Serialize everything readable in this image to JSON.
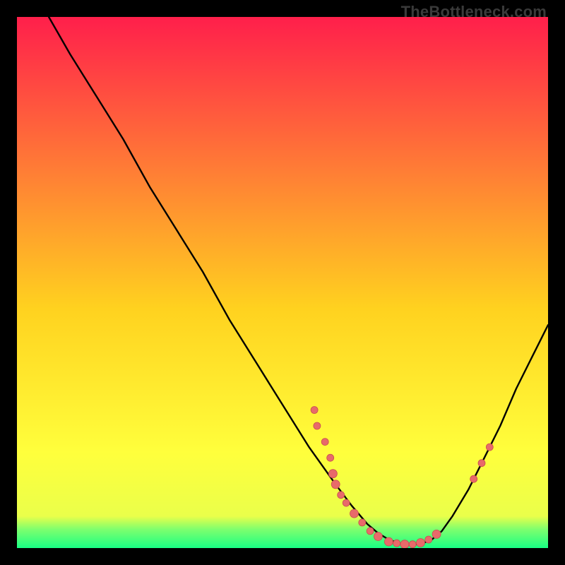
{
  "watermark": "TheBottleneck.com",
  "colors": {
    "gradient_top": "#ff1f4b",
    "gradient_mid1": "#ff7a36",
    "gradient_mid2": "#ffd21f",
    "gradient_mid3": "#ffff3c",
    "gradient_bottom_band": "#7dff6e",
    "gradient_bottom": "#19ff84",
    "curve": "#000000",
    "marker_fill": "#e86a6a",
    "marker_stroke": "#c74f4f",
    "background": "#000000"
  },
  "chart_data": {
    "type": "line",
    "title": "",
    "xlabel": "",
    "ylabel": "",
    "xlim": [
      0,
      100
    ],
    "ylim": [
      0,
      100
    ],
    "curve": [
      {
        "x": 6,
        "y": 100
      },
      {
        "x": 10,
        "y": 93
      },
      {
        "x": 15,
        "y": 85
      },
      {
        "x": 20,
        "y": 77
      },
      {
        "x": 25,
        "y": 68
      },
      {
        "x": 30,
        "y": 60
      },
      {
        "x": 35,
        "y": 52
      },
      {
        "x": 40,
        "y": 43
      },
      {
        "x": 45,
        "y": 35
      },
      {
        "x": 50,
        "y": 27
      },
      {
        "x": 55,
        "y": 19
      },
      {
        "x": 60,
        "y": 12
      },
      {
        "x": 63,
        "y": 8
      },
      {
        "x": 66,
        "y": 4.5
      },
      {
        "x": 68,
        "y": 2.8
      },
      {
        "x": 70,
        "y": 1.6
      },
      {
        "x": 72,
        "y": 0.9
      },
      {
        "x": 74,
        "y": 0.6
      },
      {
        "x": 76,
        "y": 0.8
      },
      {
        "x": 78,
        "y": 1.5
      },
      {
        "x": 80,
        "y": 3.2
      },
      {
        "x": 82,
        "y": 6
      },
      {
        "x": 85,
        "y": 11
      },
      {
        "x": 88,
        "y": 17
      },
      {
        "x": 91,
        "y": 23
      },
      {
        "x": 94,
        "y": 30
      },
      {
        "x": 97,
        "y": 36
      },
      {
        "x": 100,
        "y": 42
      }
    ],
    "markers": [
      {
        "x": 56,
        "y": 26,
        "r": 5
      },
      {
        "x": 56.5,
        "y": 23,
        "r": 5
      },
      {
        "x": 58,
        "y": 20,
        "r": 5
      },
      {
        "x": 59,
        "y": 17,
        "r": 5
      },
      {
        "x": 59.5,
        "y": 14,
        "r": 6
      },
      {
        "x": 60,
        "y": 12,
        "r": 6
      },
      {
        "x": 61,
        "y": 10,
        "r": 5
      },
      {
        "x": 62,
        "y": 8.5,
        "r": 5
      },
      {
        "x": 63.5,
        "y": 6.5,
        "r": 6
      },
      {
        "x": 65,
        "y": 4.8,
        "r": 5
      },
      {
        "x": 66.5,
        "y": 3.2,
        "r": 5
      },
      {
        "x": 68,
        "y": 2.2,
        "r": 6
      },
      {
        "x": 70,
        "y": 1.2,
        "r": 6
      },
      {
        "x": 71.5,
        "y": 0.9,
        "r": 5
      },
      {
        "x": 73,
        "y": 0.7,
        "r": 6
      },
      {
        "x": 74.5,
        "y": 0.7,
        "r": 5
      },
      {
        "x": 76,
        "y": 1.0,
        "r": 6
      },
      {
        "x": 77.5,
        "y": 1.6,
        "r": 5
      },
      {
        "x": 79,
        "y": 2.6,
        "r": 6
      },
      {
        "x": 86,
        "y": 13,
        "r": 5
      },
      {
        "x": 87.5,
        "y": 16,
        "r": 5
      },
      {
        "x": 89,
        "y": 19,
        "r": 5
      }
    ]
  }
}
